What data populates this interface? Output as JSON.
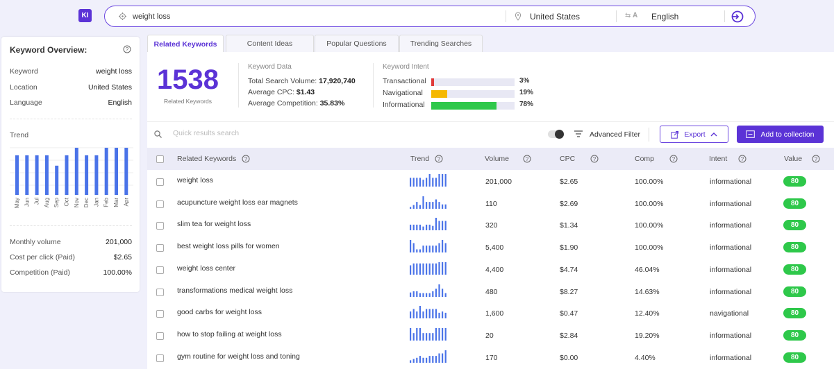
{
  "app": {
    "logo_text": "KI",
    "accent": "#5b33d6",
    "badge_color": "#2ec84a"
  },
  "search": {
    "query": "weight loss",
    "location": "United States",
    "language": "English"
  },
  "overview": {
    "title": "Keyword Overview:",
    "keyword_label": "Keyword",
    "keyword_value": "weight loss",
    "location_label": "Location",
    "location_value": "United States",
    "language_label": "Language",
    "language_value": "English",
    "trend_label": "Trend",
    "trend_months": [
      "May",
      "Jun",
      "Jul",
      "Aug",
      "Sep",
      "Oct",
      "Nov",
      "Dec",
      "Jan",
      "Feb",
      "Mar",
      "Apr"
    ],
    "trend_values": [
      0.84,
      0.84,
      0.84,
      0.84,
      0.62,
      0.84,
      1.0,
      0.84,
      0.84,
      1.0,
      1.0,
      1.0
    ],
    "monthly_volume_label": "Monthly volume",
    "monthly_volume_value": "201,000",
    "cpc_label": "Cost per click (Paid)",
    "cpc_value": "$2.65",
    "competition_label": "Competition (Paid)",
    "competition_value": "100.00%"
  },
  "tabs": [
    {
      "label": "Related Keywords",
      "active": true
    },
    {
      "label": "Content Ideas",
      "active": false
    },
    {
      "label": "Popular Questions",
      "active": false
    },
    {
      "label": "Trending Searches",
      "active": false
    }
  ],
  "summary": {
    "count": "1538",
    "count_label": "Related Keywords",
    "data_header": "Keyword Data",
    "tsv_label": "Total Search Volume:",
    "tsv_value": "17,920,740",
    "cpc_label": "Average CPC:",
    "cpc_value": "$1.43",
    "comp_label": "Average Competition:",
    "comp_value": "35.83%",
    "intent_header": "Keyword Intent",
    "intents": [
      {
        "label": "Transactional",
        "pct": "3%",
        "value": 0.03,
        "color": "#e03a3a"
      },
      {
        "label": "Navigational",
        "pct": "19%",
        "value": 0.19,
        "color": "#f5b800"
      },
      {
        "label": "Informational",
        "pct": "78%",
        "value": 0.78,
        "color": "#2ec84a"
      }
    ]
  },
  "toolbar": {
    "search_placeholder": "Quick results search",
    "advanced_filter": "Advanced Filter",
    "export": "Export",
    "add": "Add to collection"
  },
  "table": {
    "headers": {
      "keyword": "Related Keywords",
      "trend": "Trend",
      "volume": "Volume",
      "cpc": "CPC",
      "comp": "Comp",
      "intent": "Intent",
      "value": "Value"
    },
    "rows": [
      {
        "keyword": "weight loss",
        "volume": "201,000",
        "cpc": "$2.65",
        "comp": "100.00%",
        "intent": "informational",
        "value": "80",
        "trend": [
          0.7,
          0.7,
          0.7,
          0.7,
          0.55,
          0.7,
          1,
          0.7,
          0.7,
          1,
          1,
          1
        ]
      },
      {
        "keyword": "acupuncture weight loss ear magnets",
        "volume": "110",
        "cpc": "$2.69",
        "comp": "100.00%",
        "intent": "informational",
        "value": "80",
        "trend": [
          0.15,
          0.3,
          0.55,
          0.3,
          1,
          0.55,
          0.55,
          0.55,
          0.75,
          0.55,
          0.35,
          0.35
        ]
      },
      {
        "keyword": "slim tea for weight loss",
        "volume": "320",
        "cpc": "$1.34",
        "comp": "100.00%",
        "intent": "informational",
        "value": "80",
        "trend": [
          0.45,
          0.45,
          0.45,
          0.45,
          0.3,
          0.45,
          0.45,
          0.35,
          1,
          0.75,
          0.75,
          0.75
        ]
      },
      {
        "keyword": "best weight loss pills for women",
        "volume": "5,400",
        "cpc": "$1.90",
        "comp": "100.00%",
        "intent": "informational",
        "value": "80",
        "trend": [
          1,
          0.75,
          0.25,
          0.25,
          0.55,
          0.55,
          0.55,
          0.55,
          0.55,
          0.75,
          1,
          0.75
        ]
      },
      {
        "keyword": "weight loss center",
        "volume": "4,400",
        "cpc": "$4.74",
        "comp": "46.04%",
        "intent": "informational",
        "value": "80",
        "trend": [
          0.75,
          0.9,
          0.9,
          0.9,
          0.9,
          0.9,
          0.9,
          0.9,
          0.9,
          1,
          1,
          1
        ]
      },
      {
        "keyword": "transformations medical weight loss",
        "volume": "480",
        "cpc": "$8.27",
        "comp": "14.63%",
        "intent": "informational",
        "value": "80",
        "trend": [
          0.35,
          0.45,
          0.45,
          0.3,
          0.3,
          0.3,
          0.3,
          0.45,
          0.65,
          1,
          0.65,
          0.3
        ]
      },
      {
        "keyword": "good carbs for weight loss",
        "volume": "1,600",
        "cpc": "$0.47",
        "comp": "12.40%",
        "intent": "navigational",
        "value": "80",
        "trend": [
          0.55,
          0.75,
          0.55,
          1,
          0.55,
          0.75,
          0.75,
          0.75,
          0.75,
          0.45,
          0.55,
          0.45
        ]
      },
      {
        "keyword": "how to stop failing at weight loss",
        "volume": "20",
        "cpc": "$2.84",
        "comp": "19.20%",
        "intent": "informational",
        "value": "80",
        "trend": [
          1,
          0.6,
          1,
          1,
          0.6,
          0.6,
          0.6,
          0.6,
          1,
          1,
          1,
          1
        ]
      },
      {
        "keyword": "gym routine for weight loss and toning",
        "volume": "170",
        "cpc": "$0.00",
        "comp": "4.40%",
        "intent": "informational",
        "value": "80",
        "trend": [
          0.2,
          0.3,
          0.4,
          0.55,
          0.4,
          0.4,
          0.55,
          0.55,
          0.55,
          0.75,
          0.75,
          1
        ]
      }
    ]
  }
}
